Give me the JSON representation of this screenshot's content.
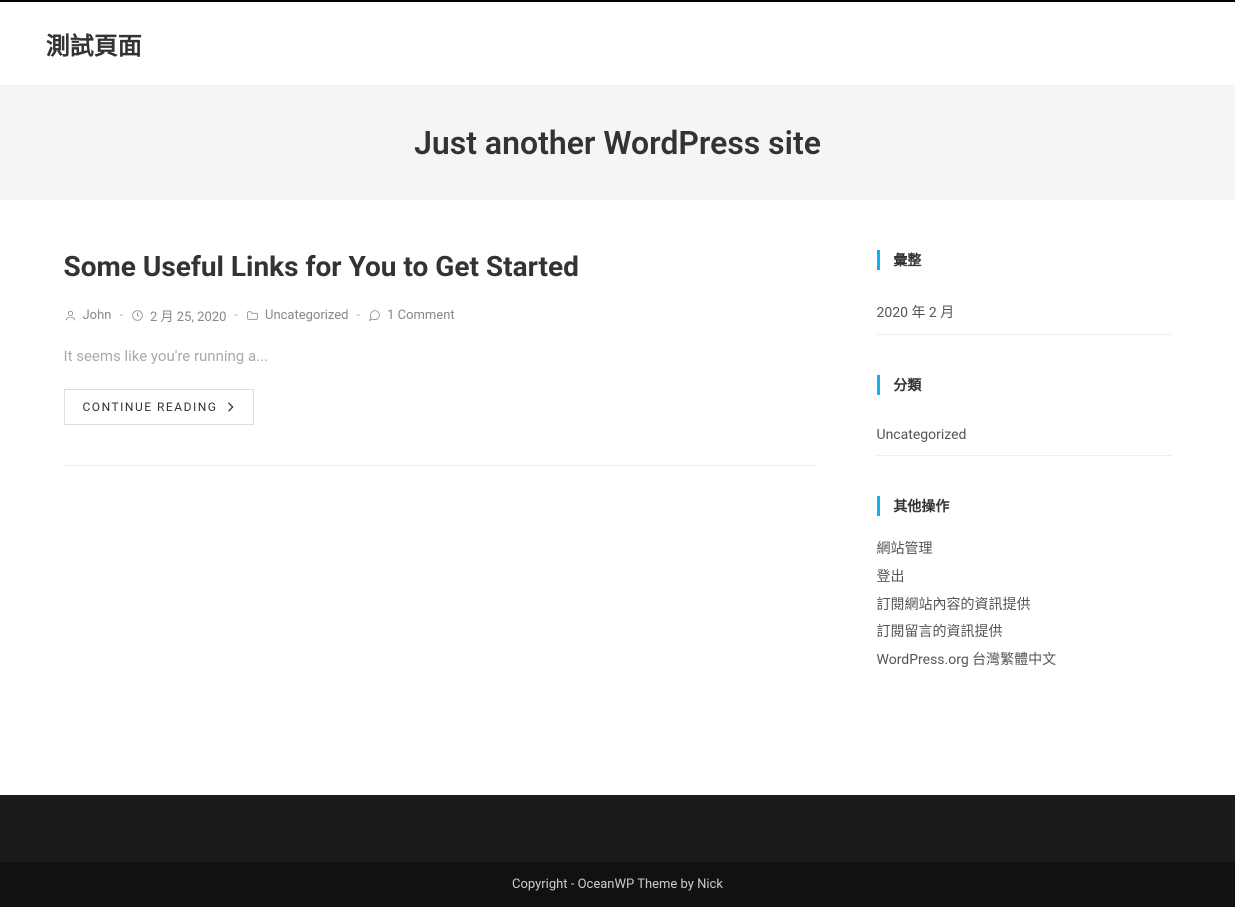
{
  "site": {
    "title": "測試頁面"
  },
  "hero": {
    "tagline": "Just another WordPress site"
  },
  "post": {
    "title": "Some Useful Links for You to Get Started",
    "author": "John",
    "date": "2 月 25, 2020",
    "category": "Uncategorized",
    "comments": "1 Comment",
    "excerpt": "It seems like you're running a...",
    "continue": "CONTINUE READING"
  },
  "sidebar": {
    "archives": {
      "title": "彙整",
      "items": [
        "2020 年 2 月"
      ]
    },
    "categories": {
      "title": "分類",
      "items": [
        "Uncategorized"
      ]
    },
    "meta": {
      "title": "其他操作",
      "items": [
        "網站管理",
        "登出",
        "訂閱網站內容的資訊提供",
        "訂閱留言的資訊提供",
        "WordPress.org 台灣繁體中文"
      ]
    }
  },
  "footer": {
    "copyright": "Copyright - OceanWP Theme by Nick"
  }
}
